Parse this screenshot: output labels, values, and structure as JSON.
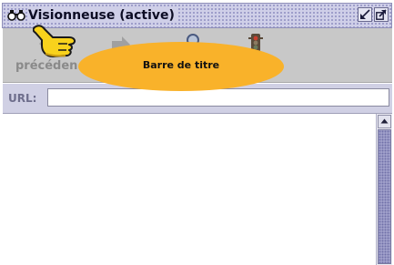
{
  "window": {
    "title": "Visionneuse (active)",
    "title_icon": "binoculars-icon"
  },
  "titlebar_buttons": [
    {
      "name": "iconify-icon"
    },
    {
      "name": "maximize-icon"
    }
  ],
  "toolbar": {
    "back_label": "précéden",
    "buttons": [
      {
        "name": "back-icon",
        "enabled": false
      },
      {
        "name": "forward-icon",
        "enabled": false
      },
      {
        "name": "search-icon",
        "enabled": false
      },
      {
        "name": "traffic-light-icon",
        "enabled": false
      }
    ]
  },
  "url": {
    "label": "URL:",
    "value": ""
  },
  "callout": {
    "text": "Barre de titre",
    "color": "#f9b22a"
  },
  "pointer": {
    "icon": "pointing-hand-icon"
  },
  "colors": {
    "titlebar": "#cfcfe8",
    "toolbar": "#c8c8c8",
    "urlbar": "#d0d0e4",
    "scroll_thumb": "#a8a8d0"
  }
}
